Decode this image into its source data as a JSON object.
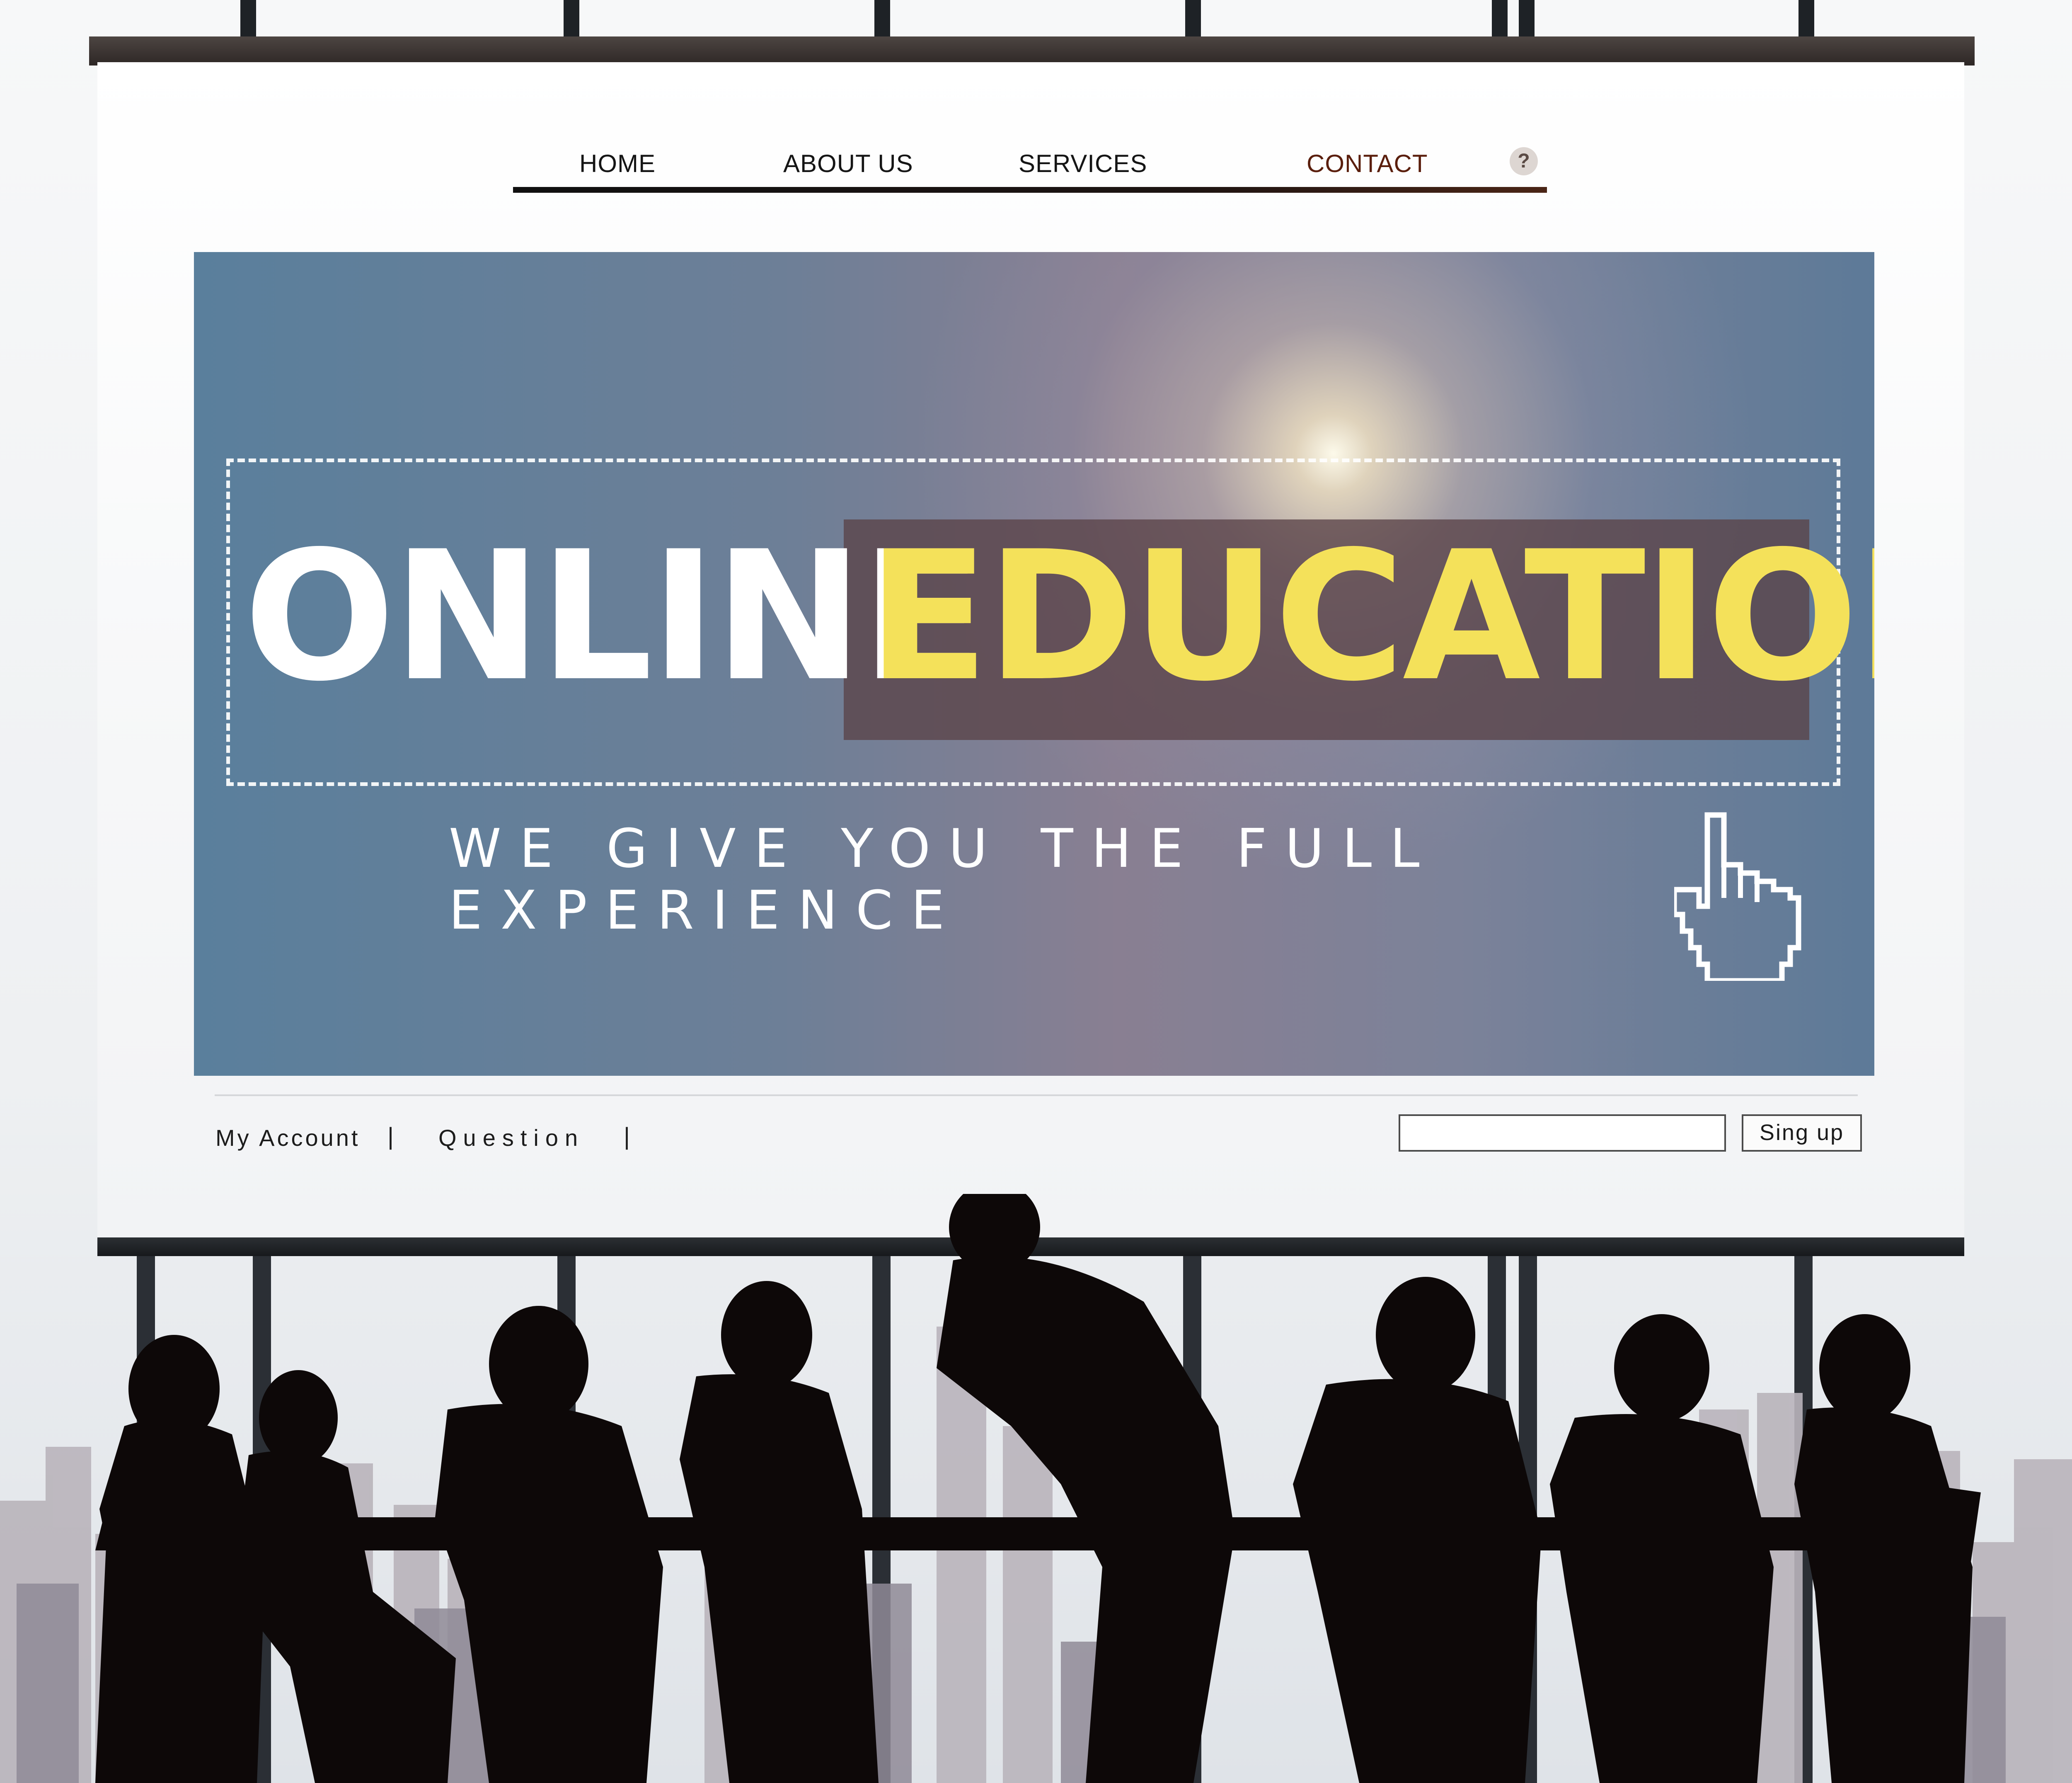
{
  "nav": {
    "items": [
      "HOME",
      "ABOUT US",
      "SERVICES",
      "CONTACT"
    ],
    "help_icon": "question-mark-icon",
    "help_symbol": "?"
  },
  "hero": {
    "title_part1": "ONLINE",
    "title_part2": "EDUCATION",
    "tagline": "WE GIVE YOU THE FULL EXPERIENCE",
    "cursor_icon": "pointing-hand-cursor-icon"
  },
  "footer": {
    "links": [
      "My Account",
      "Question"
    ],
    "separator": "|",
    "signup_label": "Sing up",
    "search_value": ""
  },
  "colors": {
    "education_text": "#f4e15a",
    "contact_text": "#5a1e0c",
    "hero_blue": "#5a7f9c"
  }
}
